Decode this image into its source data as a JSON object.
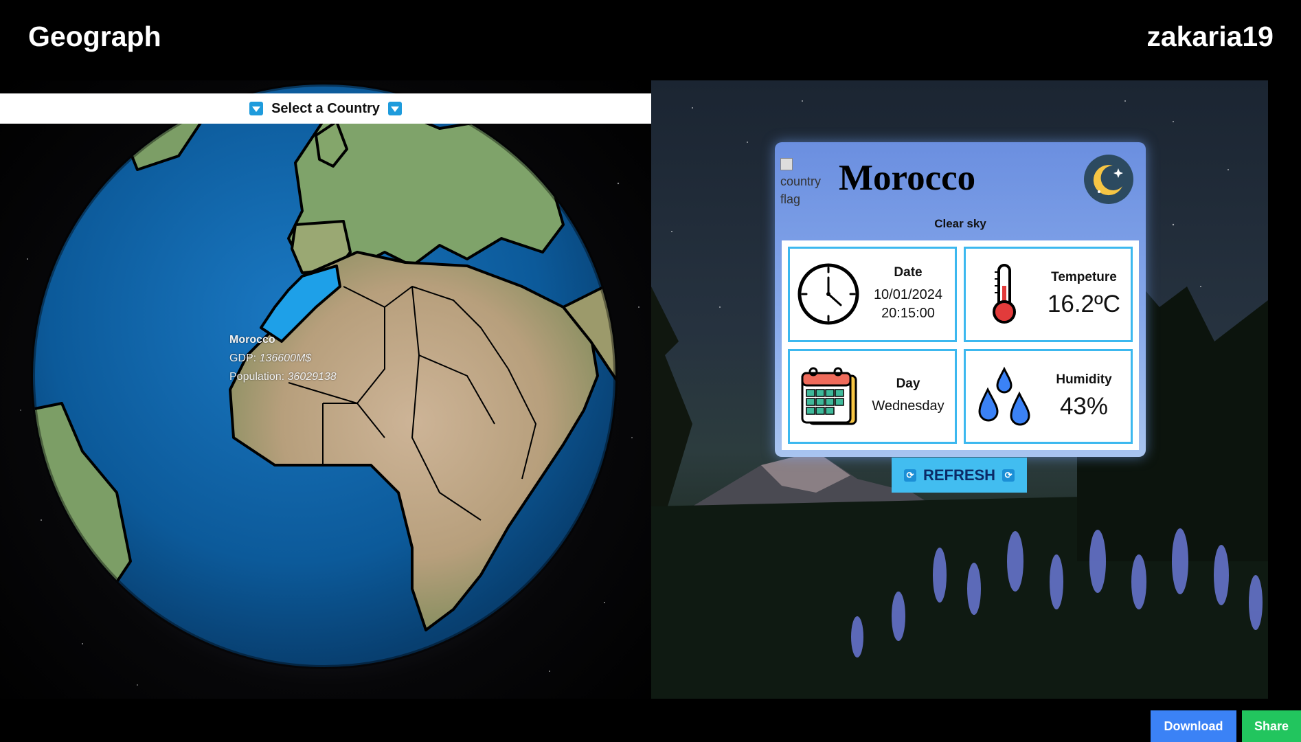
{
  "header": {
    "app_title": "Geograph",
    "username": "zakaria19"
  },
  "globe": {
    "select_label": "Select a Country",
    "tooltip": {
      "country": "Morocco",
      "gdp_label": "GDP:",
      "gdp_value": "136600M$",
      "population_label": "Population:",
      "population_value": "36029138"
    },
    "colors": {
      "ocean": "#0c5a9a",
      "selected_country": "#1ea0e8",
      "borders": "#000000"
    }
  },
  "weather_card": {
    "flag_alt": "country flag",
    "country": "Morocco",
    "condition": "Clear sky",
    "condition_icon": "moon-stars-icon",
    "date": {
      "label": "Date",
      "date_value": "10/01/2024",
      "time_value": "20:15:00",
      "icon": "clock-icon"
    },
    "temperature": {
      "label": "Tempeture",
      "value": "16.2ºC",
      "icon": "thermometer-icon"
    },
    "day": {
      "label": "Day",
      "value": "Wednesday",
      "icon": "calendar-icon"
    },
    "humidity": {
      "label": "Humidity",
      "value": "43%",
      "icon": "water-drops-icon"
    },
    "refresh_label": "REFRESH",
    "accent": "#3cb8ef"
  },
  "footer": {
    "download_label": "Download",
    "share_label": "Share"
  }
}
